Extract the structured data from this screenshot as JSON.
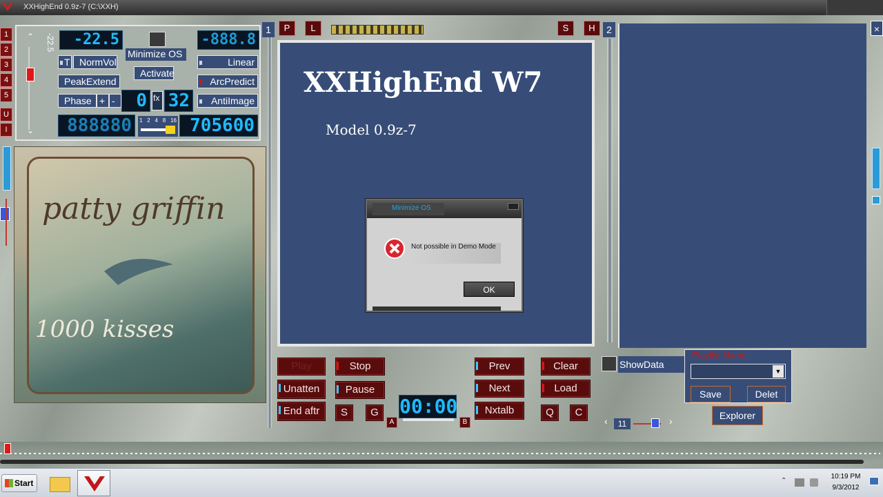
{
  "window": {
    "title": "XXHighEnd 0.9z-7 (C:\\XXH)"
  },
  "left_strip": {
    "numbers": [
      "1",
      "2",
      "3",
      "4",
      "5",
      "U",
      "I"
    ]
  },
  "control_panel": {
    "volume_readout": "-22.5",
    "lcd_left": "-22.5",
    "lcd_right": "-888.8",
    "t_label": "T",
    "normvol_label": "NormVol",
    "minimize_os_label": "Minimize OS",
    "activate_label": "Activate",
    "linear_label": "Linear",
    "peakextend_label": "PeakExtend",
    "arcpredict_label": "ArcPredict",
    "phase_label": "Phase",
    "plus_label": "+",
    "minus_label": "-",
    "fx_label": "fx",
    "lcd_mid_left": "0",
    "lcd_mid_right": "32",
    "antiimage_label": "AntiImage",
    "lcd_counter": "888880",
    "scale_ticks": [
      "1",
      "2",
      "4",
      "8",
      "16"
    ],
    "samplerate": "705600"
  },
  "album": {
    "artist_art": "patty griffin",
    "title_art": "1000 kisses"
  },
  "top_bar": {
    "marker_1": "1",
    "p_label": "P",
    "l_label": "L",
    "s_label": "S",
    "h_label": "H",
    "marker_2": "2"
  },
  "info_panel": {
    "title": "XXHighEnd W7",
    "subtitle": "Model 0.9z-7"
  },
  "dialog": {
    "title": "Minimize OS",
    "message": "Not possible in Demo Mode",
    "ok_label": "OK"
  },
  "transport": {
    "play": "Play",
    "stop": "Stop",
    "unatten": "Unatten",
    "pause": "Pause",
    "end_after": "End aftr",
    "s": "S",
    "g": "G",
    "a": "A",
    "b": "B",
    "time": "00:00",
    "prev": "Prev",
    "next": "Next",
    "nxtalb": "Nxtalb",
    "clear": "Clear",
    "load": "Load",
    "q": "Q",
    "c": "C"
  },
  "playlist": {
    "showdata_label": "ShowData",
    "playlist_name_label": "Playlist Name",
    "save_label": "Save",
    "delete_label": "Delet",
    "explorer_label": "Explorer",
    "counter": "11"
  },
  "taskbar": {
    "start_label": "Start",
    "time": "10:19 PM",
    "date": "9/3/2012"
  },
  "colors": {
    "accent_blue": "#374d77",
    "dark_red": "#5a0b0b",
    "lcd_blue": "#21b9ff"
  }
}
